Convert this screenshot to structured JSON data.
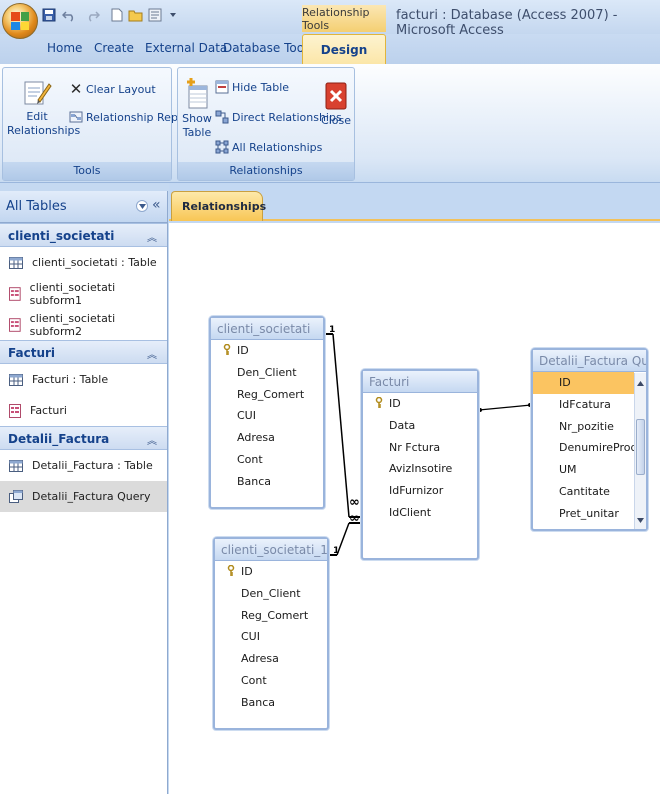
{
  "window": {
    "title": "facturi : Database (Access 2007) - Microsoft Access",
    "context_tab": "Relationship Tools"
  },
  "ribbon_tabs": [
    "Home",
    "Create",
    "External Data",
    "Database Tools",
    "Design"
  ],
  "ribbon": {
    "tools": {
      "label": "Tools",
      "edit_relationships": "Edit Relationships",
      "clear_layout": "Clear Layout",
      "relationship_report": "Relationship Report"
    },
    "relationships": {
      "label": "Relationships",
      "show_table": "Show Table",
      "hide_table": "Hide Table",
      "direct_relationships": "Direct Relationships",
      "all_relationships": "All Relationships",
      "close": "Close"
    }
  },
  "nav": {
    "title": "All Tables",
    "groups": [
      {
        "name": "clienti_societati",
        "items": [
          "clienti_societati : Table",
          "clienti_societati subform1",
          "clienti_societati subform2"
        ]
      },
      {
        "name": "Facturi",
        "items": [
          "Facturi : Table",
          "Facturi"
        ]
      },
      {
        "name": "Detalii_Factura",
        "items": [
          "Detalii_Factura : Table",
          "Detalii_Factura Query"
        ]
      }
    ]
  },
  "document_tab": "Relationships",
  "tables": {
    "clienti_societati": {
      "title": "clienti_societati",
      "fields": [
        "ID",
        "Den_Client",
        "Reg_Comert",
        "CUI",
        "Adresa",
        "Cont",
        "Banca"
      ]
    },
    "clienti_societati_1": {
      "title": "clienti_societati_1",
      "fields": [
        "ID",
        "Den_Client",
        "Reg_Comert",
        "CUI",
        "Adresa",
        "Cont",
        "Banca"
      ]
    },
    "facturi": {
      "title": "Facturi",
      "fields": [
        "ID",
        "Data",
        "Nr Fctura",
        "AvizInsotire",
        "IdFurnizor",
        "IdClient"
      ]
    },
    "detalii": {
      "title": "Detalii_Factura Query",
      "fields": [
        "ID",
        "IdFcatura",
        "Nr_pozitie",
        "DenumireProdus",
        "UM",
        "Cantitate",
        "Pret_unitar"
      ]
    }
  },
  "relation_labels": {
    "one": "1",
    "many": "∞"
  }
}
